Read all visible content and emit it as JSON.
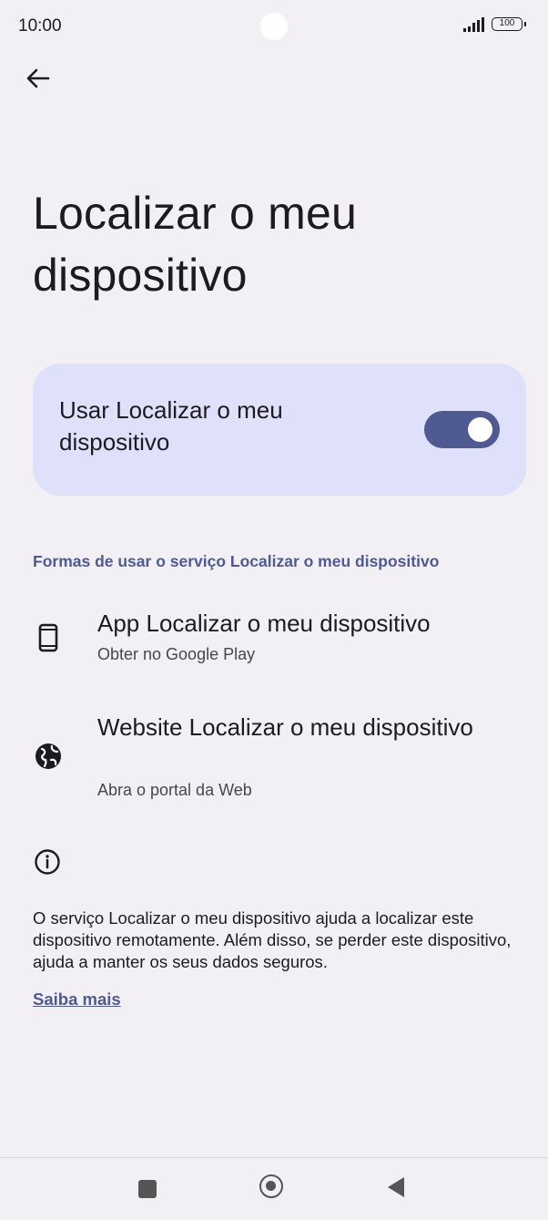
{
  "status_bar": {
    "time": "10:00",
    "battery": "100"
  },
  "page": {
    "title": "Localizar o meu dispositivo"
  },
  "toggle": {
    "label": "Usar Localizar o meu dispositivo",
    "enabled": true,
    "accent_color": "#4f5a92"
  },
  "section": {
    "header": "Formas de usar o serviço Localizar o meu dispositivo"
  },
  "options": [
    {
      "title": "App Localizar o meu dispositivo",
      "subtitle": "Obter no Google Play",
      "icon": "smartphone-icon"
    },
    {
      "title": "Website Localizar o meu dispositivo",
      "subtitle": "Abra o portal da Web",
      "icon": "globe-icon"
    }
  ],
  "info": {
    "text": "O serviço Localizar o meu dispositivo ajuda a localizar este dispositivo remotamente. Além disso, se perder este dispositivo, ajuda a manter os seus dados seguros.",
    "link": "Saiba mais"
  }
}
